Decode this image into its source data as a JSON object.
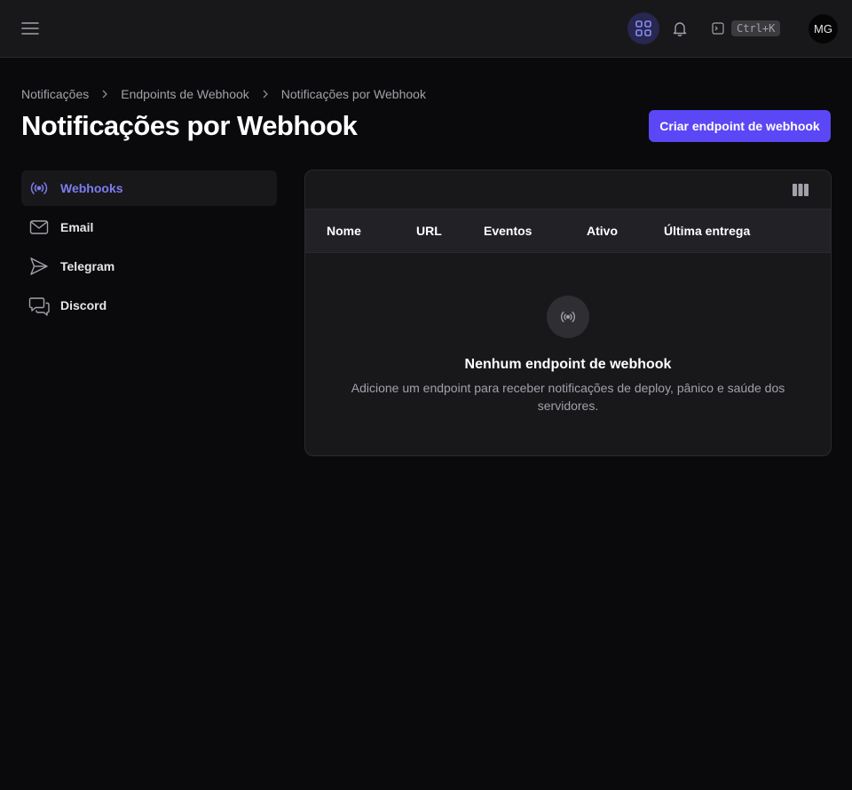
{
  "topbar": {
    "menu_icon": "hamburger-icon",
    "apps_icon": "grid-icon",
    "bell_icon": "bell-icon",
    "command_icon": "terminal-icon",
    "shortcut": "Ctrl+K",
    "avatar_initials": "MG"
  },
  "breadcrumb": [
    "Notificações",
    "Endpoints de Webhook",
    "Notificações por Webhook"
  ],
  "page": {
    "title": "Notificações por Webhook",
    "create_button": "Criar endpoint de webhook"
  },
  "sidebar": {
    "items": [
      {
        "label": "Webhooks",
        "icon": "webhook-broadcast-icon",
        "active": true
      },
      {
        "label": "Email",
        "icon": "mail-icon",
        "active": false
      },
      {
        "label": "Telegram",
        "icon": "send-icon",
        "active": false
      },
      {
        "label": "Discord",
        "icon": "chat-bubbles-icon",
        "active": false
      }
    ]
  },
  "table": {
    "columns": [
      "Nome",
      "URL",
      "Eventos",
      "Ativo",
      "Última entrega"
    ],
    "columns_toggle_icon": "columns-icon",
    "empty": {
      "icon": "webhook-broadcast-icon",
      "title": "Nenhum endpoint de webhook",
      "description": "Adicione um endpoint para receber notificações de deploy, pânico e saúde dos servidores."
    }
  },
  "colors": {
    "accent": "#5b47f5",
    "active_text": "#7c7cf0",
    "background": "#0a0a0c",
    "surface": "#18181b"
  }
}
